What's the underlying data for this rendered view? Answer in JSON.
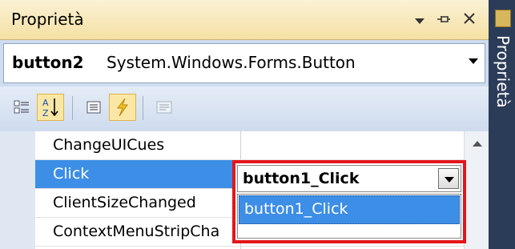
{
  "window": {
    "title": "Proprietà",
    "menu_icon": "dropdown-arrow-icon",
    "pin_icon": "pin-icon",
    "close_icon": "close-icon"
  },
  "object_selector": {
    "name": "button2",
    "type": "System.Windows.Forms.Button"
  },
  "toolbar": {
    "buttons": [
      {
        "icon": "categorized-icon",
        "active": false
      },
      {
        "icon": "alphabetical-icon",
        "active": true
      },
      {
        "icon": "properties-icon",
        "active": false
      },
      {
        "icon": "events-icon",
        "active": true
      },
      {
        "icon": "property-pages-icon",
        "active": false
      }
    ],
    "alphabetical_glyph_top": "A",
    "alphabetical_glyph_bottom": "Z"
  },
  "grid": {
    "rows": [
      {
        "name": "ChangeUICues",
        "value": ""
      },
      {
        "name": "Click",
        "value": "button1_Click",
        "selected": true
      },
      {
        "name": "ClientSizeChanged",
        "value": ""
      },
      {
        "name": "ContextMenuStripCha",
        "value": ""
      }
    ],
    "dropdown": {
      "value": "button1_Click",
      "options": [
        "button1_Click"
      ]
    }
  },
  "side_tab": {
    "label": "Proprietà"
  },
  "colors": {
    "title_bar": "#f8e8b8",
    "selection": "#3d8ee6",
    "highlight_border": "#e3161b",
    "panel": "#cfdcee"
  }
}
